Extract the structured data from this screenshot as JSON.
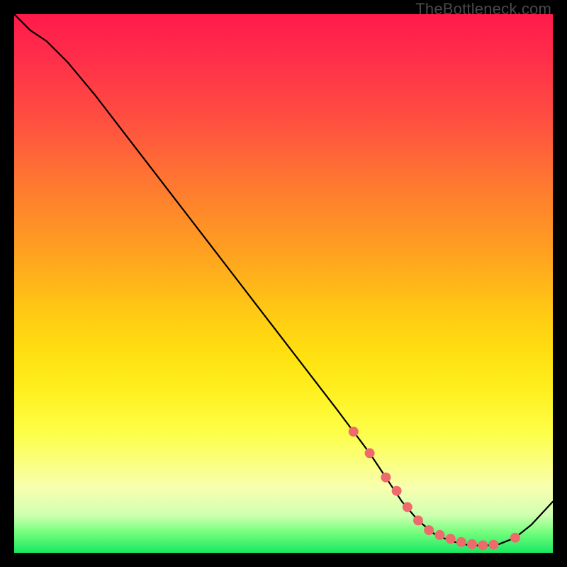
{
  "watermark": "TheBottleneck.com",
  "colors": {
    "background": "#000000",
    "gradient_top": "#ff1a4a",
    "gradient_mid": "#ffe010",
    "gradient_bottom": "#18e860",
    "curve": "#000000",
    "dots": "#ef6a6d"
  },
  "chart_data": {
    "type": "line",
    "title": "",
    "xlabel": "",
    "ylabel": "",
    "xlim": [
      0,
      100
    ],
    "ylim": [
      0,
      100
    ],
    "grid": false,
    "legend": false,
    "series": [
      {
        "name": "bottleneck-curve",
        "x": [
          0,
          3,
          6,
          10,
          15,
          20,
          25,
          30,
          35,
          40,
          45,
          50,
          55,
          60,
          63,
          66,
          69,
          72,
          75,
          78,
          81,
          84,
          87,
          90,
          93,
          96,
          100
        ],
        "y": [
          100,
          97,
          95,
          91,
          85,
          78.5,
          72,
          65.5,
          59,
          52.5,
          46,
          39.5,
          33,
          26.5,
          22.5,
          18.5,
          14,
          9.5,
          6,
          3.5,
          2.2,
          1.5,
          1.3,
          1.6,
          2.8,
          5.2,
          9.5
        ]
      }
    ],
    "highlighted_points": {
      "name": "marker-cluster",
      "x": [
        63,
        66,
        69,
        71,
        73,
        75,
        77,
        79,
        81,
        83,
        85,
        87,
        89,
        93
      ],
      "y": [
        22.5,
        18.5,
        14,
        11.5,
        8.5,
        6,
        4.2,
        3.3,
        2.6,
        2.0,
        1.6,
        1.4,
        1.5,
        2.8
      ]
    }
  }
}
